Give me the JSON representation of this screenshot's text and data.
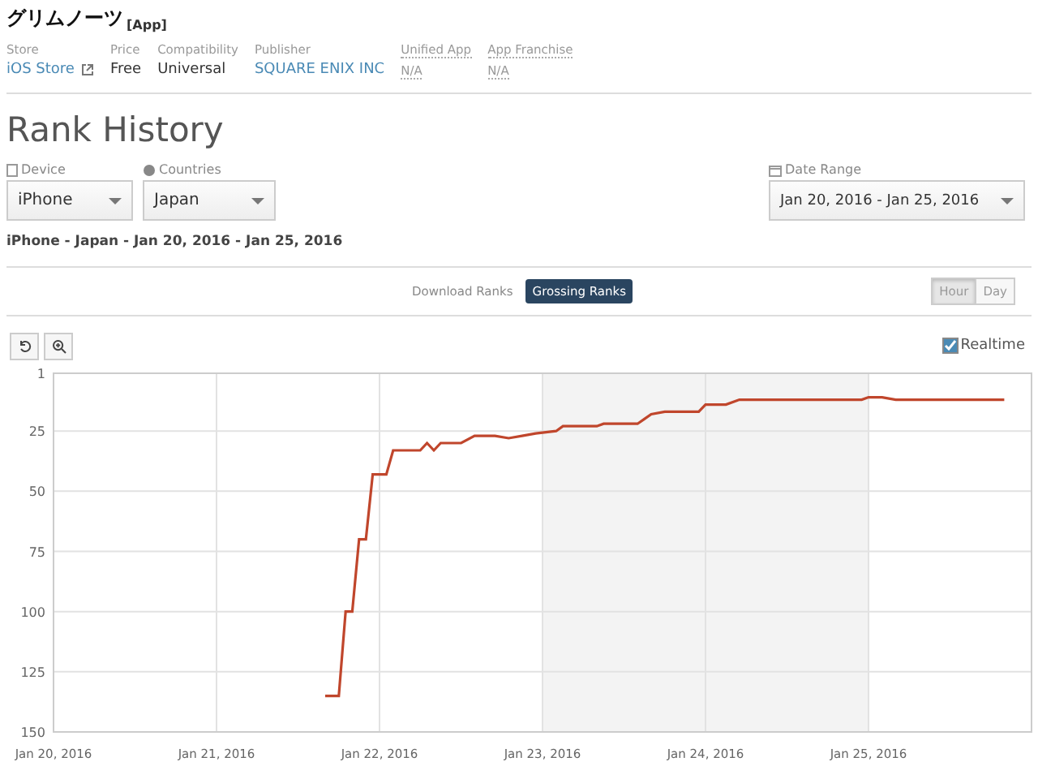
{
  "app": {
    "name": "グリムノーツ",
    "tag": "[App]"
  },
  "info": [
    {
      "label": "Store",
      "value": "iOS Store",
      "kind": "link"
    },
    {
      "label": "Price",
      "value": "Free",
      "kind": "text"
    },
    {
      "label": "Compatibility",
      "value": "Universal",
      "kind": "text"
    },
    {
      "label": "Publisher",
      "value": "SQUARE ENIX INC",
      "kind": "link"
    },
    {
      "label": "Unified App",
      "value": "N/A",
      "kind": "na"
    },
    {
      "label": "App Franchise",
      "value": "N/A",
      "kind": "na"
    }
  ],
  "heading": "Rank History",
  "filters": {
    "device": {
      "label": "Device",
      "value": "iPhone"
    },
    "countries": {
      "label": "Countries",
      "value": "Japan"
    },
    "date_range": {
      "label": "Date Range",
      "value": "Jan 20, 2016 - Jan 25, 2016"
    }
  },
  "summary": "iPhone - Japan - Jan 20, 2016 - Jan 25, 2016",
  "rank_tabs": [
    {
      "label": "Download Ranks",
      "selected": false
    },
    {
      "label": "Grossing Ranks",
      "selected": true
    }
  ],
  "granularity": [
    {
      "label": "Hour",
      "selected": true
    },
    {
      "label": "Day",
      "selected": false
    }
  ],
  "realtime": {
    "label": "Realtime",
    "checked": true
  },
  "chart_data": {
    "type": "line",
    "x": [
      "2016-01-21T16:00",
      "2016-01-21T18:00",
      "2016-01-21T19:00",
      "2016-01-21T20:00",
      "2016-01-21T21:00",
      "2016-01-21T22:00",
      "2016-01-21T23:00",
      "2016-01-22T01:00",
      "2016-01-22T02:00",
      "2016-01-22T06:00",
      "2016-01-22T07:00",
      "2016-01-22T08:00",
      "2016-01-22T09:00",
      "2016-01-22T12:00",
      "2016-01-22T14:00",
      "2016-01-22T17:00",
      "2016-01-22T19:00",
      "2016-01-22T21:00",
      "2016-01-22T23:00",
      "2016-01-23T02:00",
      "2016-01-23T03:00",
      "2016-01-23T08:00",
      "2016-01-23T09:00",
      "2016-01-23T14:00",
      "2016-01-23T15:00",
      "2016-01-23T16:00",
      "2016-01-23T18:00",
      "2016-01-23T23:00",
      "2016-01-24T00:00",
      "2016-01-24T03:00",
      "2016-01-24T05:00",
      "2016-01-24T23:00",
      "2016-01-25T00:00",
      "2016-01-25T02:00",
      "2016-01-25T04:00",
      "2016-01-25T20:00"
    ],
    "series": [
      {
        "color": "#c0462c",
        "values": [
          135,
          135,
          100,
          100,
          70,
          70,
          43,
          43,
          33,
          33,
          30,
          33,
          30,
          30,
          27,
          27,
          28,
          27,
          26,
          25,
          23,
          23,
          22,
          22,
          20,
          18,
          17,
          17,
          14,
          14,
          12,
          12,
          11,
          11,
          12,
          12
        ]
      }
    ],
    "xlim": [
      "2016-01-20T00:00",
      "2016-01-26T00:00"
    ],
    "ylim": [
      150,
      1
    ],
    "grid": true,
    "xticks": [
      {
        "value": "2016-01-20",
        "label": "Jan 20, 2016"
      },
      {
        "value": "2016-01-21",
        "label": "Jan 21, 2016"
      },
      {
        "value": "2016-01-22",
        "label": "Jan 22, 2016"
      },
      {
        "value": "2016-01-23",
        "label": "Jan 23, 2016"
      },
      {
        "value": "2016-01-24",
        "label": "Jan 24, 2016"
      },
      {
        "value": "2016-01-25",
        "label": "Jan 25, 2016"
      }
    ],
    "yticks": [
      1,
      25,
      50,
      75,
      100,
      125,
      150
    ]
  }
}
